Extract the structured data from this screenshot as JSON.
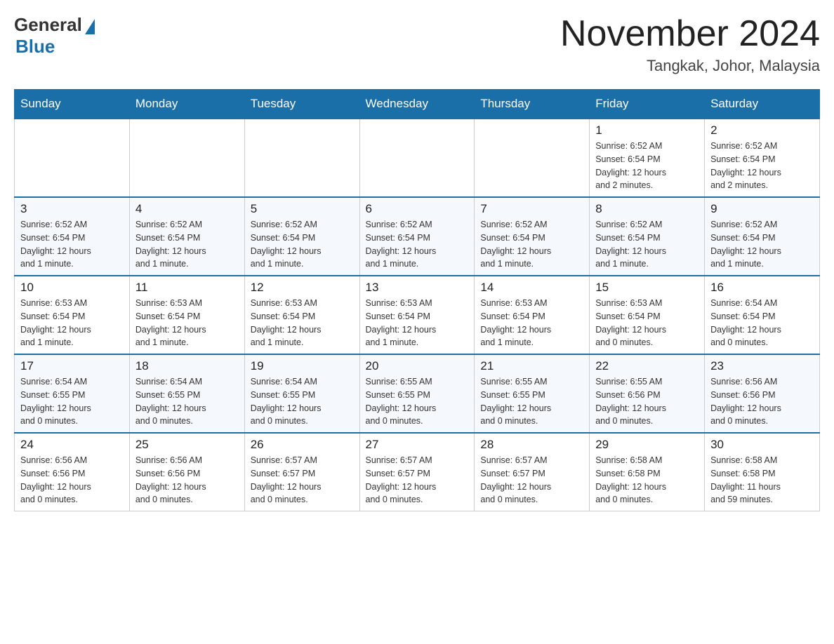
{
  "header": {
    "logo_general": "General",
    "logo_blue": "Blue",
    "month_title": "November 2024",
    "location": "Tangkak, Johor, Malaysia"
  },
  "weekdays": [
    "Sunday",
    "Monday",
    "Tuesday",
    "Wednesday",
    "Thursday",
    "Friday",
    "Saturday"
  ],
  "weeks": [
    [
      {
        "day": "",
        "info": ""
      },
      {
        "day": "",
        "info": ""
      },
      {
        "day": "",
        "info": ""
      },
      {
        "day": "",
        "info": ""
      },
      {
        "day": "",
        "info": ""
      },
      {
        "day": "1",
        "info": "Sunrise: 6:52 AM\nSunset: 6:54 PM\nDaylight: 12 hours\nand 2 minutes."
      },
      {
        "day": "2",
        "info": "Sunrise: 6:52 AM\nSunset: 6:54 PM\nDaylight: 12 hours\nand 2 minutes."
      }
    ],
    [
      {
        "day": "3",
        "info": "Sunrise: 6:52 AM\nSunset: 6:54 PM\nDaylight: 12 hours\nand 1 minute."
      },
      {
        "day": "4",
        "info": "Sunrise: 6:52 AM\nSunset: 6:54 PM\nDaylight: 12 hours\nand 1 minute."
      },
      {
        "day": "5",
        "info": "Sunrise: 6:52 AM\nSunset: 6:54 PM\nDaylight: 12 hours\nand 1 minute."
      },
      {
        "day": "6",
        "info": "Sunrise: 6:52 AM\nSunset: 6:54 PM\nDaylight: 12 hours\nand 1 minute."
      },
      {
        "day": "7",
        "info": "Sunrise: 6:52 AM\nSunset: 6:54 PM\nDaylight: 12 hours\nand 1 minute."
      },
      {
        "day": "8",
        "info": "Sunrise: 6:52 AM\nSunset: 6:54 PM\nDaylight: 12 hours\nand 1 minute."
      },
      {
        "day": "9",
        "info": "Sunrise: 6:52 AM\nSunset: 6:54 PM\nDaylight: 12 hours\nand 1 minute."
      }
    ],
    [
      {
        "day": "10",
        "info": "Sunrise: 6:53 AM\nSunset: 6:54 PM\nDaylight: 12 hours\nand 1 minute."
      },
      {
        "day": "11",
        "info": "Sunrise: 6:53 AM\nSunset: 6:54 PM\nDaylight: 12 hours\nand 1 minute."
      },
      {
        "day": "12",
        "info": "Sunrise: 6:53 AM\nSunset: 6:54 PM\nDaylight: 12 hours\nand 1 minute."
      },
      {
        "day": "13",
        "info": "Sunrise: 6:53 AM\nSunset: 6:54 PM\nDaylight: 12 hours\nand 1 minute."
      },
      {
        "day": "14",
        "info": "Sunrise: 6:53 AM\nSunset: 6:54 PM\nDaylight: 12 hours\nand 1 minute."
      },
      {
        "day": "15",
        "info": "Sunrise: 6:53 AM\nSunset: 6:54 PM\nDaylight: 12 hours\nand 0 minutes."
      },
      {
        "day": "16",
        "info": "Sunrise: 6:54 AM\nSunset: 6:54 PM\nDaylight: 12 hours\nand 0 minutes."
      }
    ],
    [
      {
        "day": "17",
        "info": "Sunrise: 6:54 AM\nSunset: 6:55 PM\nDaylight: 12 hours\nand 0 minutes."
      },
      {
        "day": "18",
        "info": "Sunrise: 6:54 AM\nSunset: 6:55 PM\nDaylight: 12 hours\nand 0 minutes."
      },
      {
        "day": "19",
        "info": "Sunrise: 6:54 AM\nSunset: 6:55 PM\nDaylight: 12 hours\nand 0 minutes."
      },
      {
        "day": "20",
        "info": "Sunrise: 6:55 AM\nSunset: 6:55 PM\nDaylight: 12 hours\nand 0 minutes."
      },
      {
        "day": "21",
        "info": "Sunrise: 6:55 AM\nSunset: 6:55 PM\nDaylight: 12 hours\nand 0 minutes."
      },
      {
        "day": "22",
        "info": "Sunrise: 6:55 AM\nSunset: 6:56 PM\nDaylight: 12 hours\nand 0 minutes."
      },
      {
        "day": "23",
        "info": "Sunrise: 6:56 AM\nSunset: 6:56 PM\nDaylight: 12 hours\nand 0 minutes."
      }
    ],
    [
      {
        "day": "24",
        "info": "Sunrise: 6:56 AM\nSunset: 6:56 PM\nDaylight: 12 hours\nand 0 minutes."
      },
      {
        "day": "25",
        "info": "Sunrise: 6:56 AM\nSunset: 6:56 PM\nDaylight: 12 hours\nand 0 minutes."
      },
      {
        "day": "26",
        "info": "Sunrise: 6:57 AM\nSunset: 6:57 PM\nDaylight: 12 hours\nand 0 minutes."
      },
      {
        "day": "27",
        "info": "Sunrise: 6:57 AM\nSunset: 6:57 PM\nDaylight: 12 hours\nand 0 minutes."
      },
      {
        "day": "28",
        "info": "Sunrise: 6:57 AM\nSunset: 6:57 PM\nDaylight: 12 hours\nand 0 minutes."
      },
      {
        "day": "29",
        "info": "Sunrise: 6:58 AM\nSunset: 6:58 PM\nDaylight: 12 hours\nand 0 minutes."
      },
      {
        "day": "30",
        "info": "Sunrise: 6:58 AM\nSunset: 6:58 PM\nDaylight: 11 hours\nand 59 minutes."
      }
    ]
  ]
}
